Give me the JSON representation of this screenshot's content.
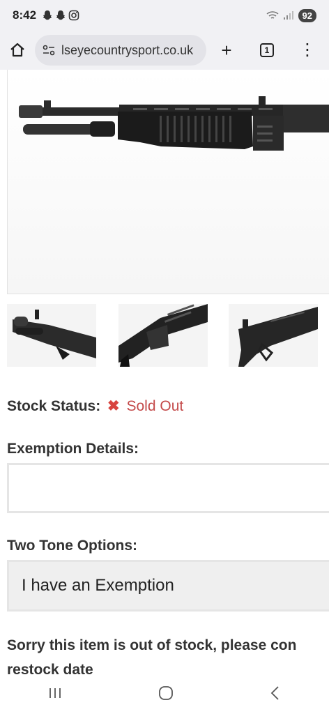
{
  "status_bar": {
    "time": "8:42",
    "battery": "92"
  },
  "browser": {
    "url": "lseyecountrysport.co.uk",
    "tab_count": "1",
    "new_tab_label": "+",
    "menu_label": "⋮"
  },
  "product": {
    "stock_status_label": "Stock Status:",
    "stock_status_value": "Sold Out",
    "exemption_label": "Exemption Details:",
    "exemption_value": "",
    "two_tone_label": "Two Tone Options:",
    "two_tone_selected": "I have an Exemption",
    "notice_line1": "Sorry this item is out of stock, please con",
    "notice_line2": "restock date"
  },
  "colors": {
    "sold_out": "#c44a4a",
    "status_bar_bg": "#f1f1f4"
  },
  "icons": {
    "home": "home-icon",
    "site_settings": "site-settings-icon",
    "sold_out": "x-icon",
    "recent_apps": "recent-apps-icon",
    "home_nav": "home-nav-icon",
    "back": "back-icon"
  }
}
